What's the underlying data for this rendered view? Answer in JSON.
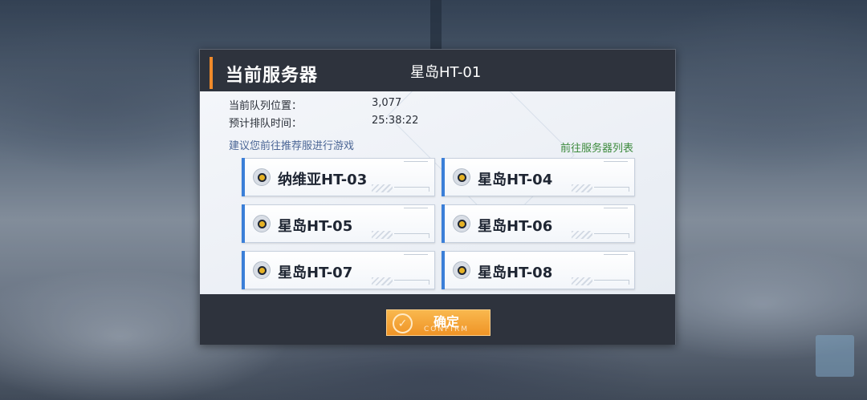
{
  "dialog": {
    "title": "当前服务器",
    "current_server": "星岛HT-01",
    "queue_position_label": "当前队列位置：",
    "queue_position_value": "3,077",
    "eta_label": "预计排队时间：",
    "eta_value": "25:38:22",
    "suggestion": "建议您前往推荐服进行游戏",
    "server_list_link": "前往服务器列表",
    "servers": [
      {
        "name": "纳维亚HT-03"
      },
      {
        "name": "星岛HT-04"
      },
      {
        "name": "星岛HT-05"
      },
      {
        "name": "星岛HT-06"
      },
      {
        "name": "星岛HT-07"
      },
      {
        "name": "星岛HT-08"
      }
    ],
    "confirm_label": "确定",
    "confirm_sub": "CONFIRM"
  },
  "colors": {
    "accent": "#f08a2a",
    "server_bar": "#3b7fd8",
    "link": "#3c8a3c",
    "header_bg": "#2e333d"
  },
  "icons": {
    "server_status": "server-status-icon",
    "confirm": "check-circle-icon"
  }
}
